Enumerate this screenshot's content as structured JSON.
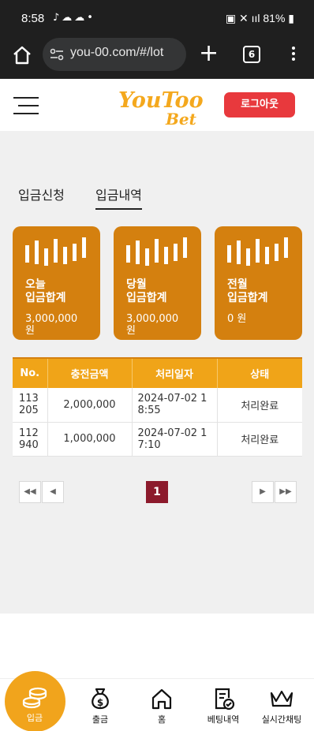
{
  "status_bar": {
    "time": "8:58",
    "battery": "81%"
  },
  "browser": {
    "url": "you-00.com/#/lot",
    "tab_count": "6"
  },
  "header": {
    "logo_line1": "YouToo",
    "logo_line2": "Bet",
    "logout_label": "로그아웃"
  },
  "tabs": [
    {
      "label": "입금신청",
      "active": false
    },
    {
      "label": "입금내역",
      "active": true
    }
  ],
  "cards": [
    {
      "label_line1": "오늘",
      "label_line2": "입금합계",
      "value_line1": "3,000,000",
      "value_line2": "원"
    },
    {
      "label_line1": "당월",
      "label_line2": "입금합계",
      "value_line1": "3,000,000",
      "value_line2": "원"
    },
    {
      "label_line1": "전월",
      "label_line2": "입금합계",
      "value_line1": "0 원",
      "value_line2": ""
    }
  ],
  "table": {
    "headers": [
      "No.",
      "충전금액",
      "처리일자",
      "상태"
    ],
    "rows": [
      {
        "no_line1": "113",
        "no_line2": "205",
        "amount": "2,000,000",
        "date_line1": "2024-07-02 1",
        "date_line2": "8:55",
        "status": "처리완료"
      },
      {
        "no_line1": "112",
        "no_line2": "940",
        "amount": "1,000,000",
        "date_line1": "2024-07-02 1",
        "date_line2": "7:10",
        "status": "처리완료"
      }
    ]
  },
  "pagination": {
    "current": "1",
    "first": "◀◀",
    "prev": "◀",
    "next": "▶",
    "last": "▶▶"
  },
  "bottom_nav": [
    {
      "label": "입금",
      "icon": "coins-icon",
      "active": true
    },
    {
      "label": "출금",
      "icon": "money-bag-icon",
      "active": false
    },
    {
      "label": "홈",
      "icon": "home-icon",
      "active": false
    },
    {
      "label": "베팅내역",
      "icon": "betting-history-icon",
      "active": false
    },
    {
      "label": "실시간채팅",
      "icon": "crown-icon",
      "active": false
    }
  ],
  "colors": {
    "accent_orange": "#d4800f",
    "table_header": "#f0a418",
    "logout_red": "#e8393d",
    "pager_active": "#8c1a2c"
  }
}
